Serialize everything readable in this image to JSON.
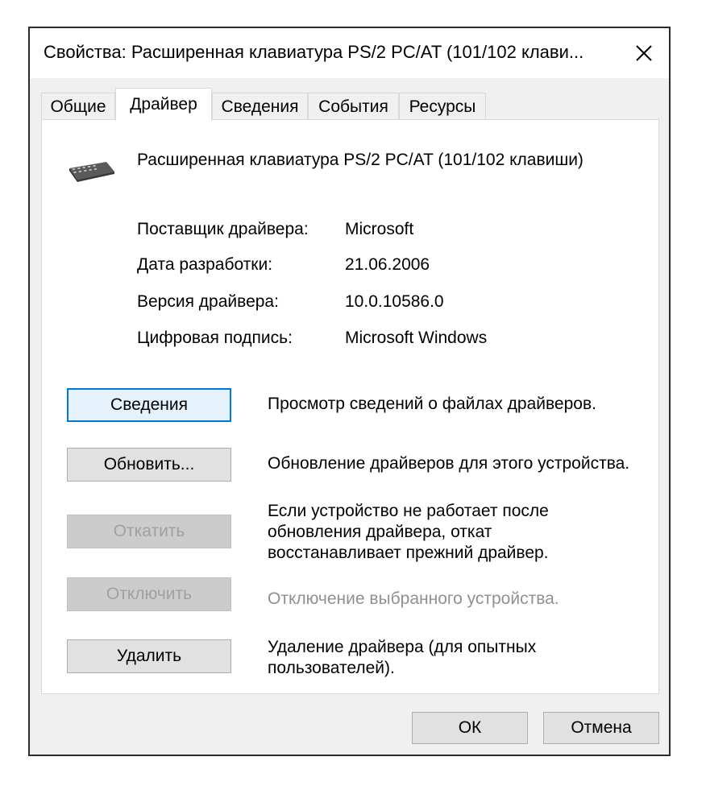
{
  "window": {
    "title": "Свойства: Расширенная клавиатура PS/2 PC/AT (101/102 клави..."
  },
  "tabs": [
    {
      "label": "Общие"
    },
    {
      "label": "Драйвер"
    },
    {
      "label": "Сведения"
    },
    {
      "label": "События"
    },
    {
      "label": "Ресурсы"
    }
  ],
  "active_tab": "Драйвер",
  "device": {
    "icon": "keyboard-icon",
    "name": "Расширенная клавиатура PS/2 PC/AT (101/102 клавиши)"
  },
  "properties": [
    {
      "label": "Поставщик драйвера:",
      "value": "Microsoft"
    },
    {
      "label": "Дата разработки:",
      "value": "21.06.2006"
    },
    {
      "label": "Версия драйвера:",
      "value": "10.0.10586.0"
    },
    {
      "label": "Цифровая подпись:",
      "value": "Microsoft Windows"
    }
  ],
  "actions": [
    {
      "button": "Сведения",
      "desc": "Просмотр сведений о файлах драйверов.",
      "enabled": true
    },
    {
      "button": "Обновить...",
      "desc": "Обновление драйверов для этого устройства.",
      "enabled": true
    },
    {
      "button": "Откатить",
      "desc": "Если устройство не работает после обновления драйвера, откат восстанавливает прежний драйвер.",
      "enabled": false
    },
    {
      "button": "Отключить",
      "desc": "Отключение выбранного устройства.",
      "enabled": false
    },
    {
      "button": "Удалить",
      "desc": "Удаление драйвера (для опытных пользователей).",
      "enabled": true
    }
  ],
  "footer": {
    "ok_label": "ОК",
    "cancel_label": "Отмена"
  },
  "colors": {
    "focus_accent": "#0078d7",
    "disabled_text": "#a0a0a0"
  }
}
